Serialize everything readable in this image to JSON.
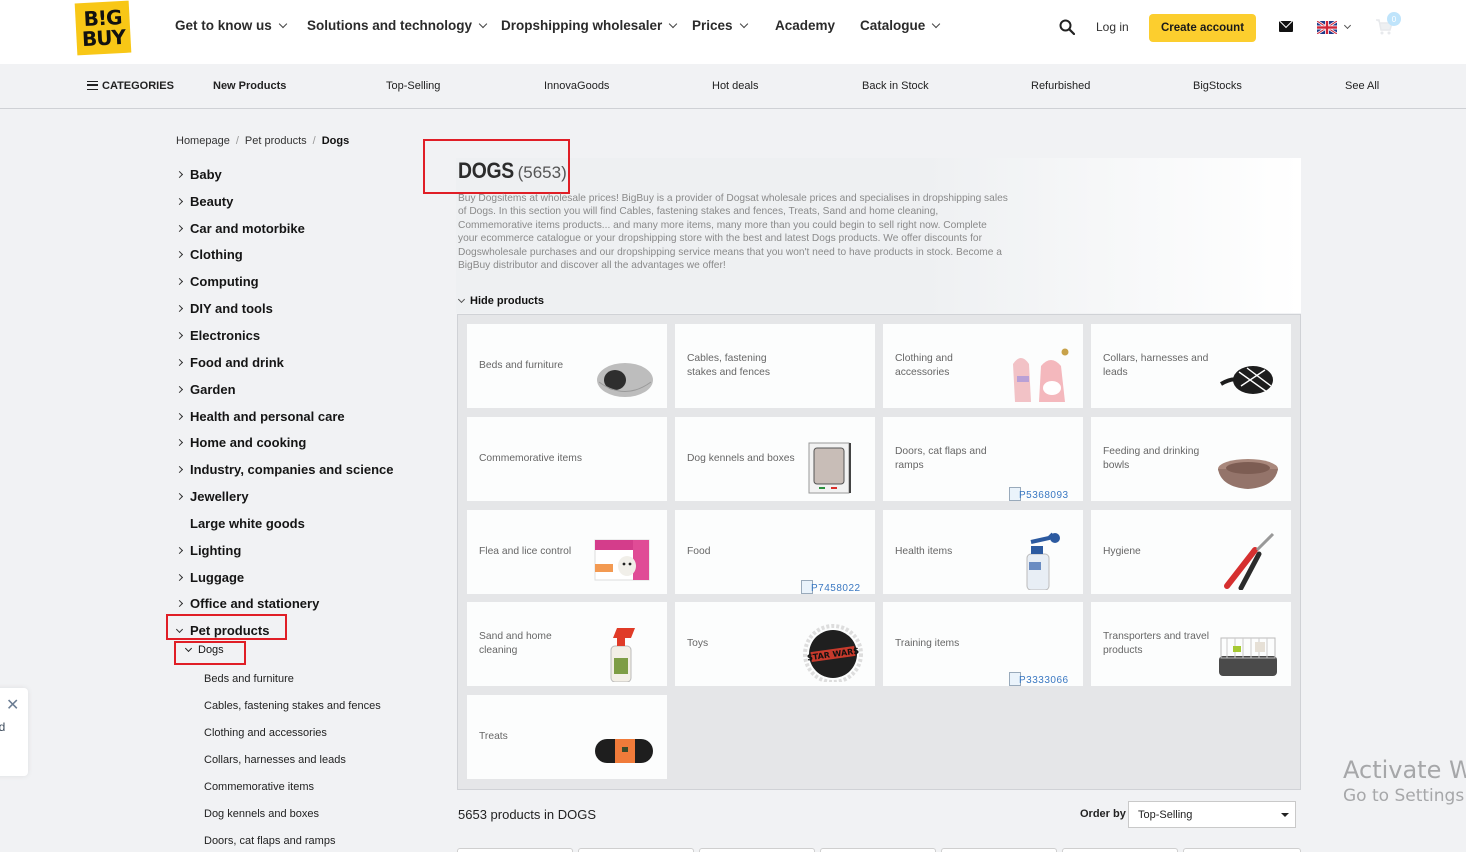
{
  "header": {
    "logo_line1": "B!G",
    "logo_line2": "BUY",
    "nav": [
      {
        "label": "Get to know us",
        "dropdown": true
      },
      {
        "label": "Solutions and technology",
        "dropdown": true
      },
      {
        "label": "Dropshipping wholesaler",
        "dropdown": true
      },
      {
        "label": "Prices",
        "dropdown": true
      },
      {
        "label": "Academy",
        "dropdown": false
      },
      {
        "label": "Catalogue",
        "dropdown": true
      }
    ],
    "login": "Log in",
    "create_account": "Create account",
    "cart_count": "0",
    "language_flag": "uk-flag-icon"
  },
  "subnav": {
    "categories": "CATEGORIES",
    "items": [
      "New Products",
      "Top-Selling",
      "InnovaGoods",
      "Hot deals",
      "Back in Stock",
      "Refurbished",
      "BigStocks",
      "See All"
    ]
  },
  "breadcrumb": [
    "Homepage",
    "Pet products",
    "Dogs"
  ],
  "sidebar": {
    "categories": [
      {
        "label": "Baby",
        "arrow": "right"
      },
      {
        "label": "Beauty",
        "arrow": "right"
      },
      {
        "label": "Car and motorbike",
        "arrow": "right"
      },
      {
        "label": "Clothing",
        "arrow": "right"
      },
      {
        "label": "Computing",
        "arrow": "right"
      },
      {
        "label": "DIY and tools",
        "arrow": "right"
      },
      {
        "label": "Electronics",
        "arrow": "right"
      },
      {
        "label": "Food and drink",
        "arrow": "right"
      },
      {
        "label": "Garden",
        "arrow": "right"
      },
      {
        "label": "Health and personal care",
        "arrow": "right"
      },
      {
        "label": "Home and cooking",
        "arrow": "right"
      },
      {
        "label": "Industry, companies and science",
        "arrow": "right"
      },
      {
        "label": "Jewellery",
        "arrow": "right"
      },
      {
        "label": "Large white goods",
        "arrow": "none"
      },
      {
        "label": "Lighting",
        "arrow": "right"
      },
      {
        "label": "Luggage",
        "arrow": "right"
      },
      {
        "label": "Office and stationery",
        "arrow": "right"
      },
      {
        "label": "Pet products",
        "arrow": "down"
      }
    ],
    "active_sub": "Dogs",
    "subcategories": [
      "Beds and furniture",
      "Cables, fastening stakes and fences",
      "Clothing and accessories",
      "Collars, harnesses and leads",
      "Commemorative items",
      "Dog kennels and boxes",
      "Doors, cat flaps and ramps"
    ]
  },
  "main": {
    "title": "DOGS",
    "count": "(5653)",
    "description": "Buy Dogsitems at wholesale prices! BigBuy is a provider of Dogsat wholesale prices and specialises in dropshipping sales of Dogs. In this section you will find Cables, fastening stakes and fences, Treats, Sand and home cleaning, Commemorative items products... and many more items, many more than you could begin to sell right now. Complete your ecommerce catalogue or your dropshipping store with the best and latest Dogs products. We offer discounts for Dogswholesale purchases and our dropshipping service means that you won't need to have products in stock. Become a BigBuy distributor and discover all the advantages we offer!",
    "hide_products": "Hide products",
    "tiles": [
      {
        "label": "Beds and furniture",
        "image": "cat-bed"
      },
      {
        "label": "Cables, fastening stakes and fences",
        "image": "none"
      },
      {
        "label": "Clothing and accessories",
        "image": "pink-hoodies"
      },
      {
        "label": "Collars, harnesses and leads",
        "image": "muzzle"
      },
      {
        "label": "Commemorative items",
        "image": "none"
      },
      {
        "label": "Dog kennels and boxes",
        "image": "pet-door"
      },
      {
        "label": "Doors, cat flaps and ramps",
        "image": "broken",
        "broken_text": "P5368093"
      },
      {
        "label": "Feeding and drinking bowls",
        "image": "bowl"
      },
      {
        "label": "Flea and lice control",
        "image": "frontline-box"
      },
      {
        "label": "Food",
        "image": "broken",
        "broken_text": "P7458022"
      },
      {
        "label": "Health items",
        "image": "spray-bottle"
      },
      {
        "label": "Hygiene",
        "image": "nail-clipper"
      },
      {
        "label": "Sand and home cleaning",
        "image": "cleaning-spray"
      },
      {
        "label": "Toys",
        "image": "star-wars-toy"
      },
      {
        "label": "Training items",
        "image": "broken",
        "broken_text": "P3333066"
      },
      {
        "label": "Transporters and travel products",
        "image": "cage"
      },
      {
        "label": "Treats",
        "image": "treat-bag"
      }
    ],
    "products_count_text": "5653 products in DOGS",
    "order_by_label": "Order by",
    "order_by_value": "Top-Selling"
  },
  "toast": {
    "text": "ld"
  },
  "watermark": {
    "line1": "Activate Wi",
    "line2": "Go to Settings t"
  },
  "colors": {
    "brand_yellow": "#fcce2e",
    "highlight_red": "#e01e26",
    "background": "#f1f2f4"
  }
}
